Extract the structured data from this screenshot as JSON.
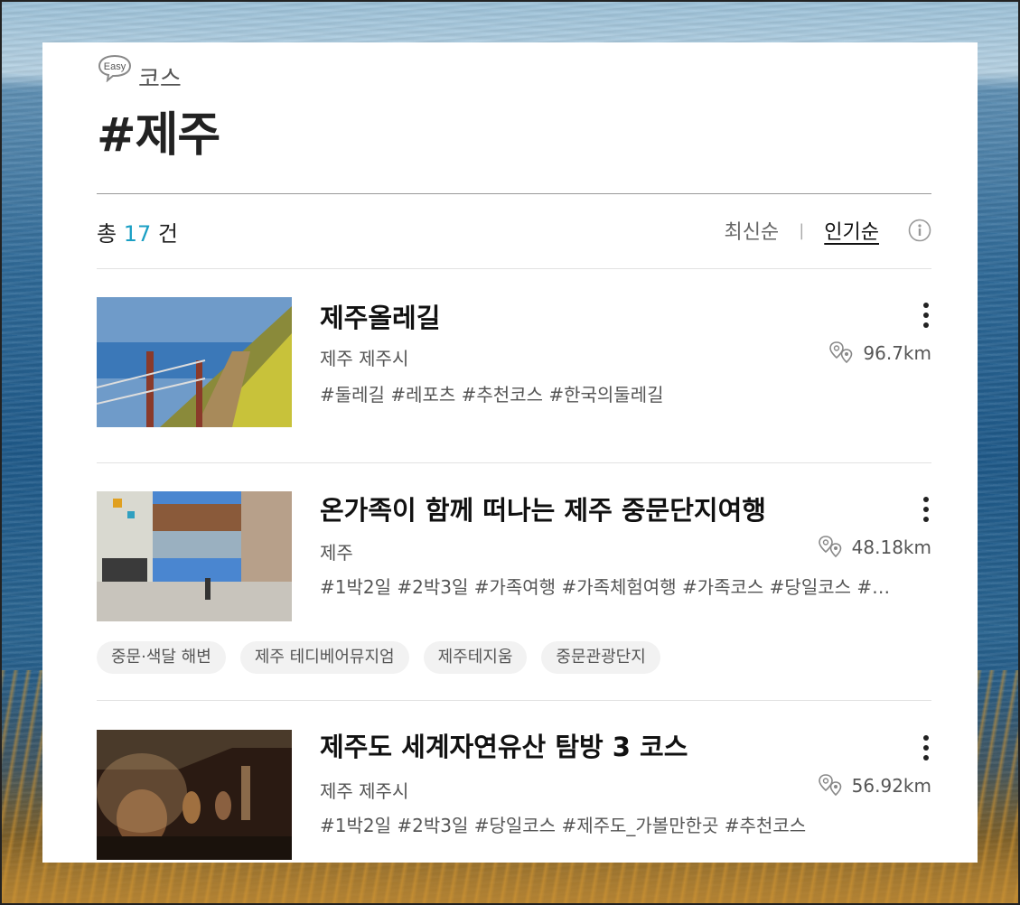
{
  "header": {
    "badge": "Easy",
    "subtitle": "코스",
    "title": "#제주"
  },
  "toolbar": {
    "count_prefix": "총",
    "count_value": "17",
    "count_suffix": "건",
    "sort_latest": "최신순",
    "sort_separator": "|",
    "sort_popular": "인기순",
    "info_icon": "info-icon"
  },
  "courses": [
    {
      "title": "제주올레길",
      "location": "제주 제주시",
      "distance": "96.7km",
      "tags": "#둘레길 #레포츠 #추천코스 #한국의둘레길",
      "thumb_colors": [
        "#5d8fc0",
        "#c9c24a"
      ]
    },
    {
      "title": "온가족이 함께 떠나는 제주 중문단지여행",
      "location": "제주",
      "distance": "48.18km",
      "tags": "#1박2일 #2박3일 #가족여행 #가족체험여행 #가족코스 #당일코스 #…",
      "chips": [
        "중문·색달 해변",
        "제주 테디베어뮤지엄",
        "제주테지움",
        "중문관광단지"
      ],
      "thumb_colors": [
        "#3b78c9",
        "#8a5a3a"
      ]
    },
    {
      "title": "제주도 세계자연유산 탐방 3 코스",
      "location": "제주 제주시",
      "distance": "56.92km",
      "tags": "#1박2일 #2박3일 #당일코스 #제주도_가볼만한곳 #추천코스",
      "thumb_colors": [
        "#2a1a10",
        "#c9a070"
      ]
    }
  ]
}
